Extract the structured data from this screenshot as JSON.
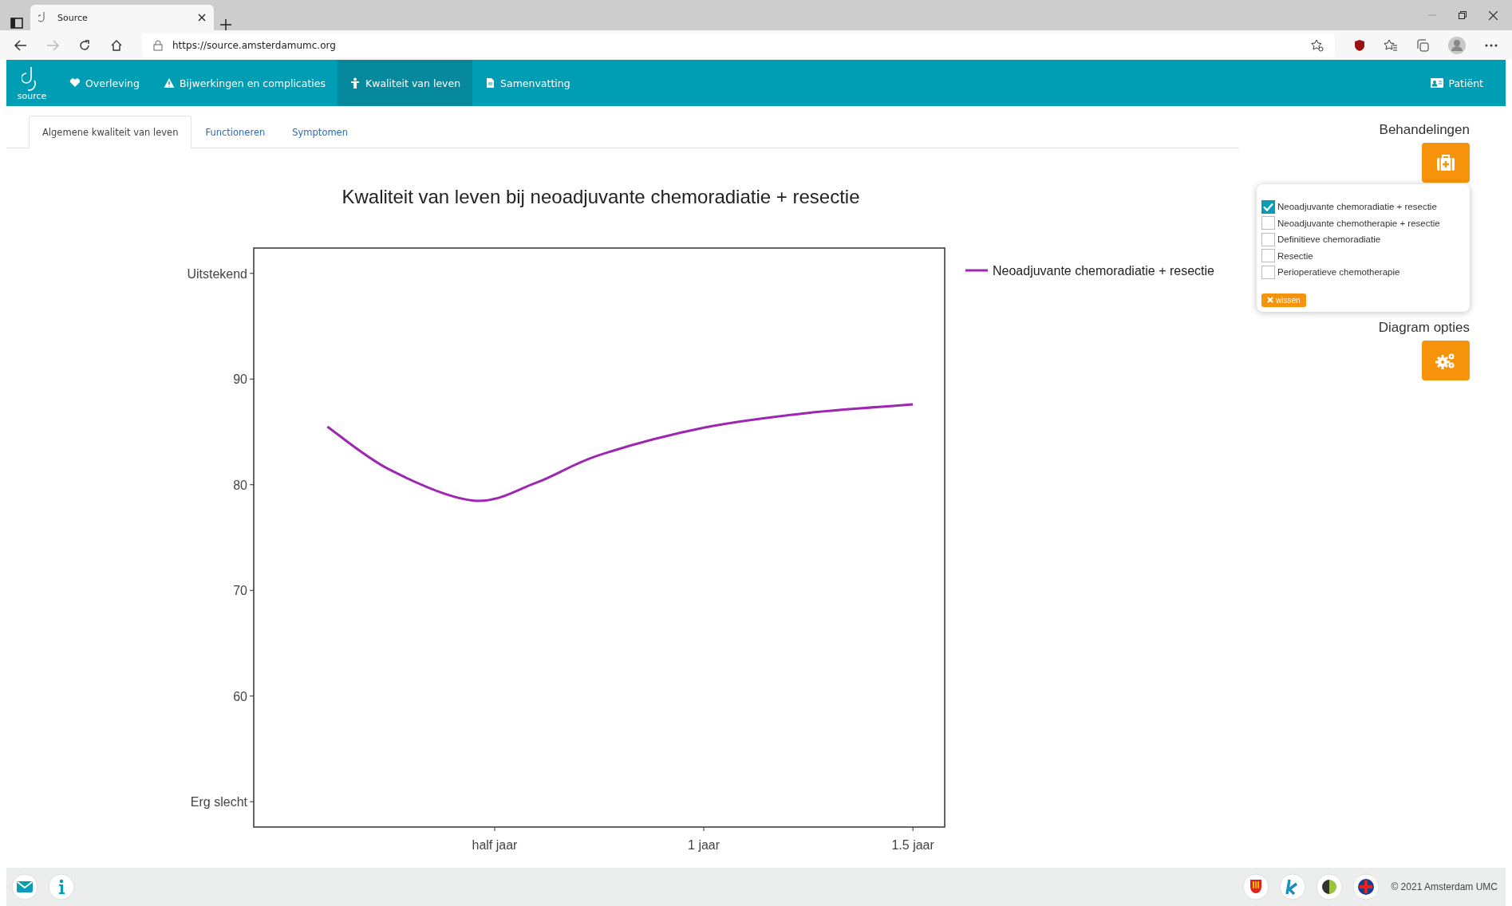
{
  "browser": {
    "tab_title": "Source",
    "url": "https://source.amsterdamumc.org"
  },
  "nav": {
    "logo_text": "source",
    "items": [
      {
        "label": "Overleving",
        "selected": false
      },
      {
        "label": "Bijwerkingen en complicaties",
        "selected": false
      },
      {
        "label": "Kwaliteit van leven",
        "selected": true
      },
      {
        "label": "Samenvatting",
        "selected": false
      }
    ],
    "patient": "Patiënt"
  },
  "subtabs": [
    {
      "label": "Algemene kwaliteit van leven",
      "selected": true
    },
    {
      "label": "Functioneren",
      "selected": false
    },
    {
      "label": "Symptomen",
      "selected": false
    }
  ],
  "chart": {
    "chart_data": {
      "type": "line",
      "title": "Kwaliteit van leven bij neoadjuvante chemoradiatie + resectie",
      "x": [
        0.1,
        0.25,
        0.45,
        0.6,
        0.75,
        1.0,
        1.25,
        1.5
      ],
      "series": [
        {
          "name": "Neoadjuvante chemoradiatie + resectie",
          "color": "#9c27b0",
          "values": [
            85.5,
            81.4,
            78.5,
            80.2,
            82.8,
            85.4,
            86.8,
            87.6
          ]
        }
      ],
      "xlim": [
        -0.076,
        1.576
      ],
      "ylim": [
        47.6,
        102.4
      ],
      "xticks": [
        {
          "value": 0.5,
          "label": "half jaar"
        },
        {
          "value": 1,
          "label": "1 jaar"
        },
        {
          "value": 1.5,
          "label": "1.5 jaar"
        }
      ],
      "yticks": [
        {
          "value": 50,
          "label": "Erg slecht"
        },
        60,
        70,
        80,
        90,
        {
          "value": 100,
          "label": "Uitstekend"
        }
      ]
    }
  },
  "sidebar": {
    "treatments_title": "Behandelingen",
    "treatments": [
      {
        "label": "Neoadjuvante chemoradiatie + resectie",
        "checked": true
      },
      {
        "label": "Neoadjuvante chemotherapie + resectie",
        "checked": false
      },
      {
        "label": "Definitieve chemoradiatie",
        "checked": false
      },
      {
        "label": "Resectie",
        "checked": false
      },
      {
        "label": "Perioperatieve chemotherapie",
        "checked": false
      }
    ],
    "clear_button": "wissen",
    "options_title": "Diagram opties"
  },
  "footer": {
    "copyright": "© 2021 Amsterdam UMC"
  }
}
